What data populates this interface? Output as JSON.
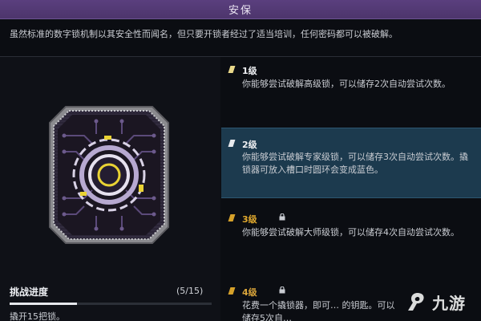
{
  "header": {
    "title": "安保"
  },
  "description": "虽然标准的数字锁机制以其安全性而闻名，但只要开锁者经过了适当培训，任何密码都可以被破解。",
  "progress": {
    "title": "挑战进度",
    "count": "(5/15)",
    "fraction": 0.333,
    "text": "撬开15把锁。"
  },
  "levels": [
    {
      "name": "1级",
      "text": "你能够尝试破解高级锁，可以储存2次自动尝试次数。",
      "locked": false,
      "selected": false
    },
    {
      "name": "2级",
      "text": "你能够尝试破解专家级锁，可以储存3次自动尝试次数。撬锁器可放入槽口时圆环会变成蓝色。",
      "locked": false,
      "selected": true
    },
    {
      "name": "3级",
      "text": "你能够尝试破解大师级锁，可以储存4次自动尝试次数。",
      "locked": true,
      "selected": false
    },
    {
      "name": "4级",
      "text": "花费一个撬锁器，即可… 的钥匙。可以储存5次自…",
      "locked": true,
      "selected": false
    }
  ],
  "watermark": {
    "text": "九游",
    "logo": "jiuyou-logo"
  },
  "colors": {
    "header": "#4d356c",
    "selected_row": "#1c3a4e",
    "gold": "#d6a12a"
  }
}
